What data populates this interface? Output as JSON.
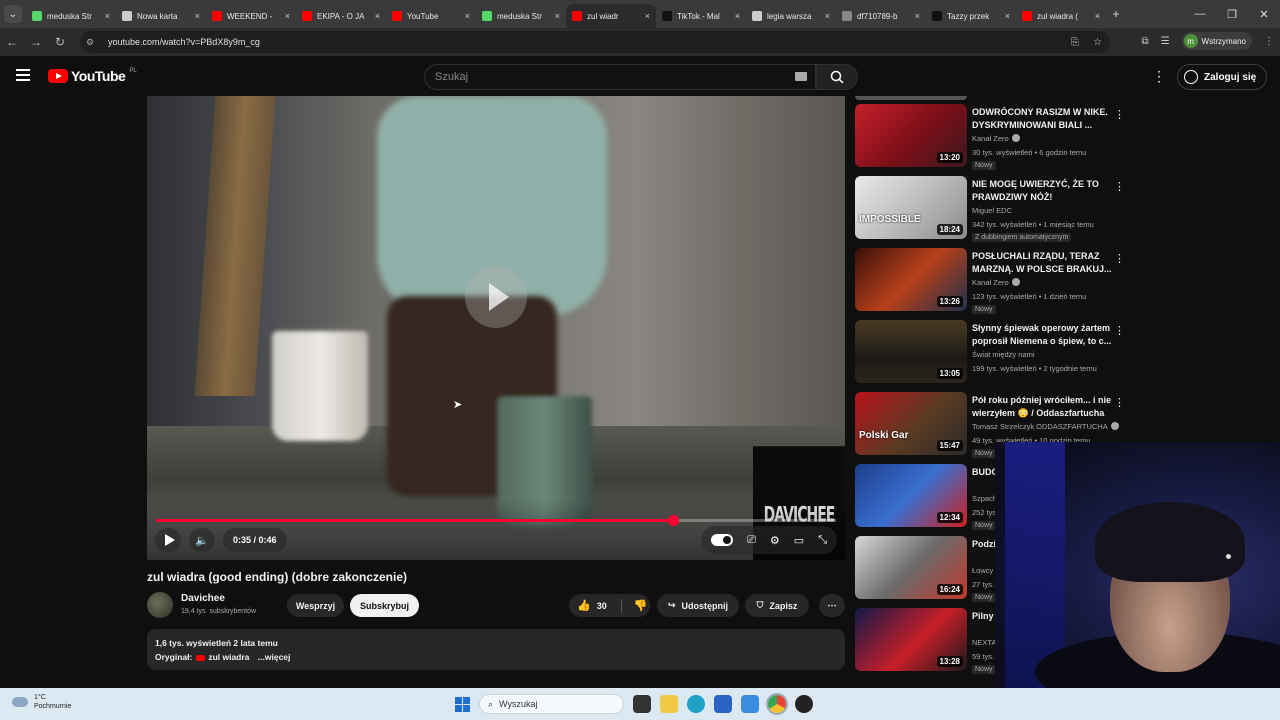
{
  "browser": {
    "tabs": [
      {
        "label": "meduska Str",
        "color": "#53d769"
      },
      {
        "label": "Nowa karta",
        "color": "#cccccc"
      },
      {
        "label": "WEEKEND -",
        "color": "#ff0000"
      },
      {
        "label": "EKIPA - O JA",
        "color": "#ff0000"
      },
      {
        "label": "YouTube",
        "color": "#ff0000"
      },
      {
        "label": "meduska Str",
        "color": "#53d769"
      },
      {
        "label": "zul wiadr",
        "color": "#ff0000"
      },
      {
        "label": "TikTok - Mal",
        "color": "#111111"
      },
      {
        "label": "legia warsza",
        "color": "#cccccc"
      },
      {
        "label": "df710789-b",
        "color": "#888888"
      },
      {
        "label": "Tazzy przek",
        "color": "#111111"
      },
      {
        "label": "zul wiadra (",
        "color": "#ff0000"
      }
    ],
    "url": "youtube.com/watch?v=PBdX8y9m_cg",
    "profile_label": "Wstrzymano",
    "profile_initial": "m"
  },
  "youtube": {
    "logo_text": "YouTube",
    "logo_country": "PL",
    "search_placeholder": "Szukaj",
    "signin_label": "Zaloguj się"
  },
  "player": {
    "watermark": "DAVICHEE",
    "time": "0:35 / 0:46",
    "progress": 0.76
  },
  "video": {
    "title": "zul wiadra (good ending) (dobre zakonczenie)",
    "channel": "Davichee",
    "subscribers": "19,4 tys. subskrybentów",
    "support_label": "Wesprzyj",
    "subscribe_label": "Subskrybuj",
    "likes": "30",
    "share_label": "Udostępnij",
    "save_label": "Zapisz",
    "views_date": "1,6 tys. wyświetleń  2 lata temu",
    "original_label": "Oryginał:",
    "original_title": "zul wiadra",
    "more_label": "...więcej"
  },
  "recommendations": [
    {
      "title": "ODWRÓCONY RASIZM W NIKE. DYSKRYMINOWANI BIALI ...",
      "channel": "Kanał Zero",
      "verified": true,
      "meta": "30 tys. wyświetleń • 6 godzin temu",
      "badge": "Nowy",
      "duration": "13:20",
      "thumb_text": "",
      "thumb_bg": "linear-gradient(135deg,#c51f2a,#7a0f18 55%,#3a1a1e)"
    },
    {
      "title": "NIE MOGĘ UWIERZYĆ, ŻE TO PRAWDZIWY NÓŻ!",
      "channel": "Miguel EDC",
      "verified": false,
      "meta": "342 tys. wyświetleń • 1 miesiąc temu",
      "badge": "Z dubbingiem automatycznym",
      "duration": "18:24",
      "thumb_text": "IMPOSSIBLE",
      "thumb_bg": "linear-gradient(135deg,#e9e9e9,#bdbdbd 50%,#8a8a8a)"
    },
    {
      "title": "POSŁUCHALI RZĄDU, TERAZ MARZNĄ. W POLSCE BRAKUJ...",
      "channel": "Kanał Zero",
      "verified": true,
      "meta": "123 tys. wyświetleń • 1 dzień temu",
      "badge": "Nowy",
      "duration": "13:26",
      "thumb_text": "",
      "thumb_bg": "linear-gradient(135deg,#3a1108,#b8401a 50%,#21304a)"
    },
    {
      "title": "Słynny śpiewak operowy żartem poprosił Niemena o śpiew, to c...",
      "channel": "Świat między nami",
      "verified": false,
      "meta": "199 tys. wyświetleń • 2 tygodnie temu",
      "badge": "",
      "duration": "13:05",
      "thumb_text": "",
      "thumb_bg": "linear-gradient(180deg,#4a3a22,#1c1a18 60%,#2c241a)"
    },
    {
      "title": "Pół roku później wróciłem... i nie wierzyłem 😳 / Oddaszfartucha",
      "channel": "Tomasz Strzelczyk ODDASZFARTUCHA",
      "verified": true,
      "meta": "49 tys. wyświetleń • 10 godzin temu",
      "badge": "Nowy",
      "duration": "15:47",
      "thumb_text": "Polski Gar",
      "thumb_bg": "linear-gradient(135deg,#b8141c,#5a3a22 55%,#2a2a2a)"
    },
    {
      "title": "BUDOWA POMOC...",
      "channel": "Szpachla",
      "verified": false,
      "meta": "252 tys. wyświetleń",
      "badge": "Nowy",
      "duration": "12:34",
      "thumb_text": "",
      "thumb_bg": "linear-gradient(135deg,#1d3f8a,#3a6fd0 50%,#cc2020)"
    },
    {
      "title": "Podziały połowy...",
      "channel": "Łowcy",
      "verified": false,
      "meta": "27 tys. wyświetleń",
      "badge": "Nowy",
      "duration": "16:24",
      "thumb_text": "",
      "thumb_bg": "linear-gradient(135deg,#d9d9d9,#6b6b6b 50%,#c0392b)"
    },
    {
      "title": "Pilny apel opusz...",
      "channel": "NEXTA",
      "verified": false,
      "meta": "59 tys. wyświetleń",
      "badge": "Nowy",
      "duration": "13:28",
      "thumb_text": "",
      "thumb_bg": "linear-gradient(135deg,#101a4a,#c81e28 55%,#1b1b1b)"
    }
  ],
  "taskbar": {
    "temperature": "1°C",
    "weather": "Pochmurnie",
    "search_placeholder": "Wyszukaj"
  }
}
